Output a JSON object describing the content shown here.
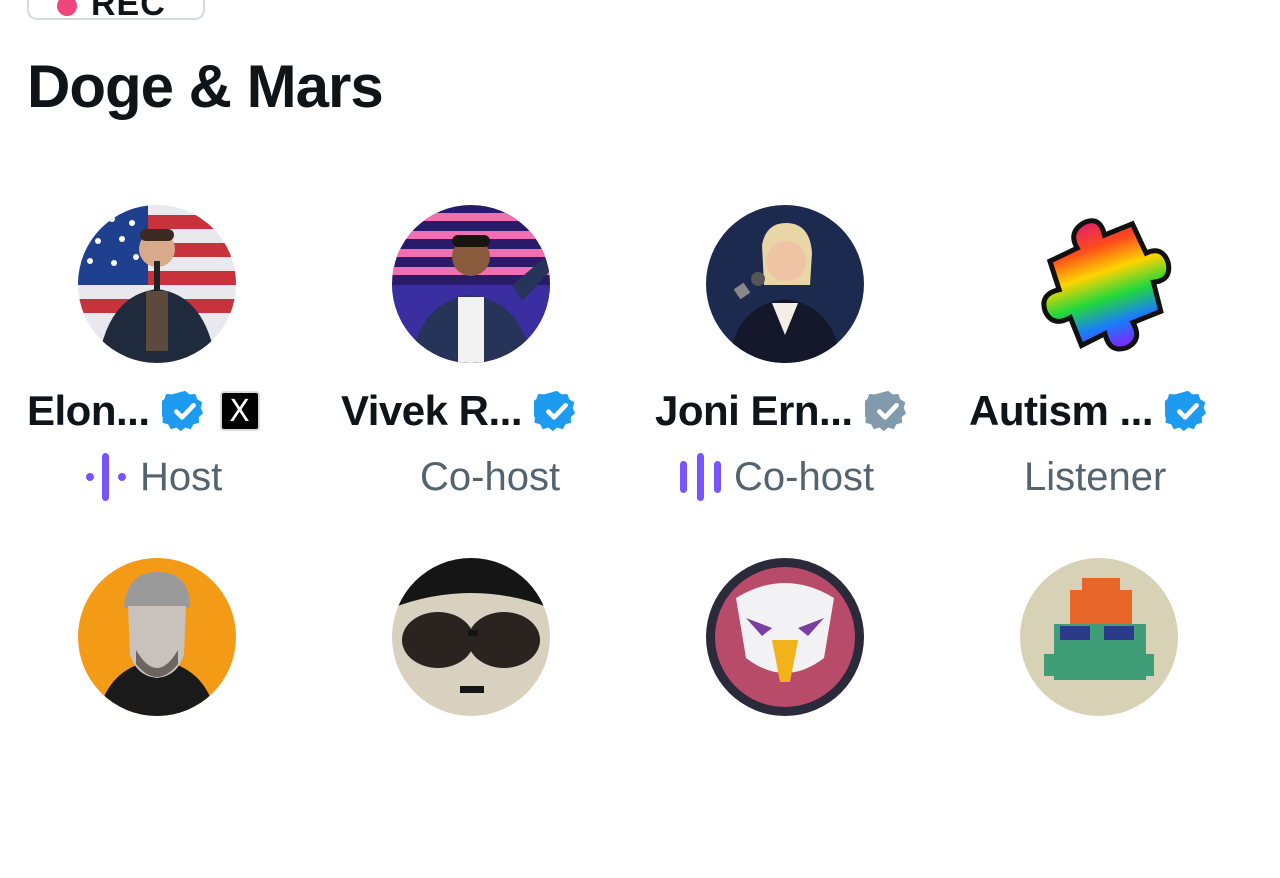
{
  "recording": {
    "label": "REC",
    "dot_color": "#f0467e"
  },
  "space": {
    "title": "Doge & Mars"
  },
  "participants": [
    {
      "name": "Elon...",
      "role": "Host",
      "verified_color": "#1d9bf0",
      "affiliate_badge": "X"
    },
    {
      "name": "Vivek R...",
      "role": "Co-host",
      "verified_color": "#1d9bf0"
    },
    {
      "name": "Joni Ern...",
      "role": "Co-host",
      "verified_color": "#829aab"
    },
    {
      "name": "Autism ...",
      "role": "Listener",
      "verified_color": "#1d9bf0"
    }
  ],
  "colors": {
    "speaking_indicator": "#7856ff",
    "role_text": "#536471"
  },
  "icons": [
    "verified-badge-icon",
    "x-logo-icon",
    "speaking-waveform-icon"
  ]
}
